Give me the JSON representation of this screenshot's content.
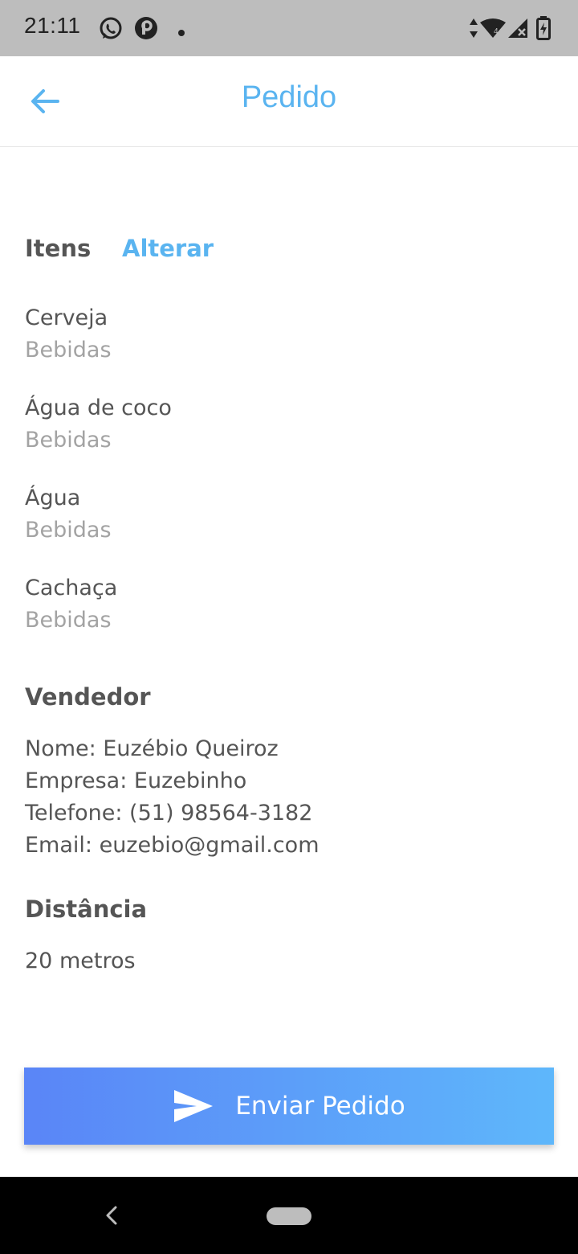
{
  "status_bar": {
    "time": "21:11",
    "icons": [
      "whatsapp-icon",
      "pinterest-icon",
      "notification-dot-icon",
      "data-arrows-icon",
      "wifi-icon",
      "signal-icon",
      "battery-charging-icon"
    ],
    "background": "#bdbdbd"
  },
  "app_bar": {
    "title": "Pedido",
    "back_icon": "arrow-left-icon",
    "accent": "#5ab4f0"
  },
  "items_section": {
    "title": "Itens",
    "edit_label": "Alterar",
    "items": [
      {
        "name": "Cerveja",
        "category": "Bebidas"
      },
      {
        "name": "Água de coco",
        "category": "Bebidas"
      },
      {
        "name": "Água",
        "category": "Bebidas"
      },
      {
        "name": "Cachaça",
        "category": "Bebidas"
      }
    ]
  },
  "vendor_section": {
    "title": "Vendedor",
    "lines": [
      "Nome: Euzébio Queiroz",
      "Empresa: Euzebinho",
      "Telefone: (51) 98564-3182",
      "Email: euzebio@gmail.com"
    ]
  },
  "distance_section": {
    "title": "Distância",
    "value": "20 metros"
  },
  "send_button": {
    "label": "Enviar Pedido",
    "icon": "send-icon",
    "gradient_start": "#5a85f7",
    "gradient_end": "#5eb7fb"
  },
  "nav_bar": {
    "icons": [
      "nav-back-icon",
      "nav-home-pill"
    ]
  }
}
